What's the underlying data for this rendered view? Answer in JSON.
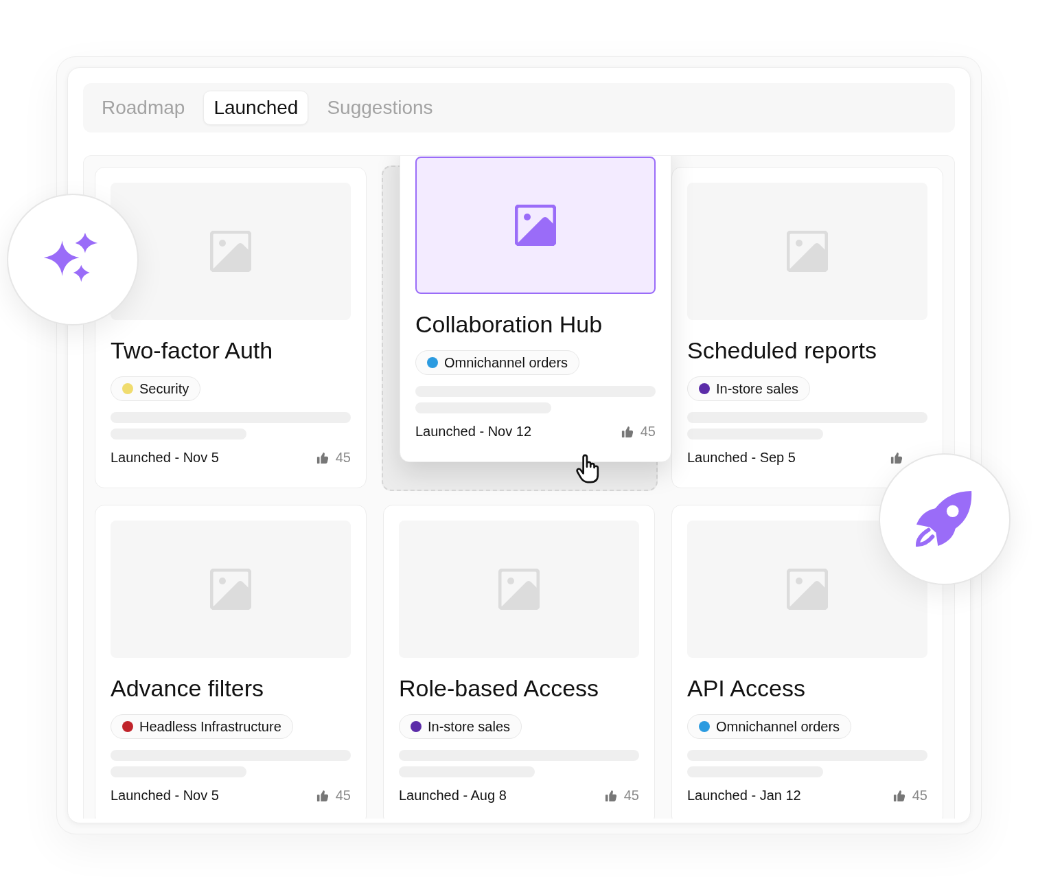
{
  "tabs": [
    {
      "label": "Roadmap",
      "selected": false
    },
    {
      "label": "Launched",
      "selected": true
    },
    {
      "label": "Suggestions",
      "selected": false
    }
  ],
  "cards": [
    {
      "title": "Two-factor Auth",
      "tag": {
        "label": "Security",
        "color": "#f0dc6e"
      },
      "status": "Launched - Nov 5",
      "votes": "45",
      "dragging": false
    },
    {
      "title": "Collaboration Hub",
      "tag": {
        "label": "Omnichannel orders",
        "color": "#2b9be0"
      },
      "status": "Launched - Nov 12",
      "votes": "45",
      "dragging": true
    },
    {
      "title": "Scheduled reports",
      "tag": {
        "label": "In-store sales",
        "color": "#5b2ca8"
      },
      "status": "Launched - Sep 5",
      "dragging": false
    },
    {
      "title": "Advance filters",
      "tag": {
        "label": "Headless Infrastructure",
        "color": "#c0232a"
      },
      "status": "Launched - Nov 5",
      "votes": "45",
      "dragging": false
    },
    {
      "title": "Role-based Access",
      "tag": {
        "label": "In-store sales",
        "color": "#5b2ca8"
      },
      "status": "Launched - Aug 8",
      "votes": "45",
      "dragging": false
    },
    {
      "title": "API Access",
      "tag": {
        "label": "Omnichannel orders",
        "color": "#2b9be0"
      },
      "status": "Launched - Jan 12",
      "votes": "45",
      "dragging": false
    }
  ]
}
